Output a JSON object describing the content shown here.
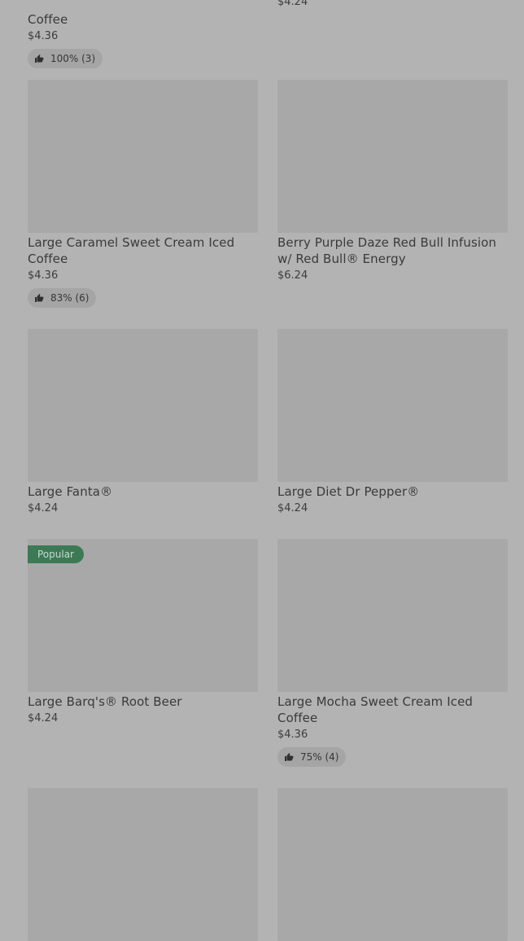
{
  "cards": [
    {
      "name": "Coffee",
      "price": "$4.36",
      "rating": "100% (3)"
    },
    {
      "name": "",
      "price": "$4.24"
    },
    {
      "name": "Large Caramel Sweet Cream Iced Coffee",
      "price": "$4.36",
      "rating": "83% (6)"
    },
    {
      "name": "Berry Purple Daze Red Bull Infusion w/ Red Bull® Energy",
      "price": "$6.24"
    },
    {
      "name": "Large Fanta®",
      "price": "$4.24"
    },
    {
      "name": "Large Diet Dr Pepper®",
      "price": "$4.24"
    },
    {
      "name": "Large Barq's® Root Beer",
      "price": "$4.24",
      "badge": "Popular"
    },
    {
      "name": "Large Mocha Sweet Cream Iced Coffee",
      "price": "$4.36",
      "rating": "75% (4)"
    },
    {
      "name": "",
      "price": ""
    },
    {
      "name": "",
      "price": ""
    }
  ],
  "icons": {
    "thumbs_up": "thumbs-up-icon"
  }
}
